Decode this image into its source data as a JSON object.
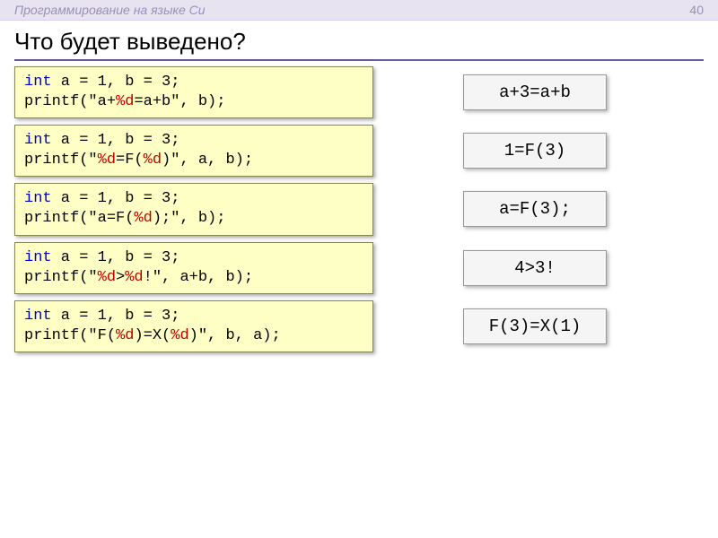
{
  "header": {
    "course": "Программирование на языке Си",
    "page": "40"
  },
  "title": "Что будет выведено?",
  "examples": [
    {
      "l1_kw": "int",
      "l1_rest": " a = 1, b = 3;",
      "l2_pre": "printf(\"a+",
      "l2_red": "%d",
      "l2_post": "=a+b\", b);",
      "output": "a+3=a+b"
    },
    {
      "l1_kw": "int",
      "l1_rest": " a = 1, b = 3;",
      "l2_pre": "printf(\"",
      "l2_red": "%d",
      "l2_mid": "=F(",
      "l2_red2": "%d",
      "l2_post": ")\", a, b);",
      "output": "1=F(3)"
    },
    {
      "l1_kw": "int",
      "l1_rest": " a = 1, b = 3;",
      "l2_pre": "printf(\"a=F(",
      "l2_red": "%d",
      "l2_post": ");\", b);",
      "output": "a=F(3);"
    },
    {
      "l1_kw": "int",
      "l1_rest": " a = 1, b = 3;",
      "l2_pre": "printf(\"",
      "l2_red": "%d",
      "l2_mid": ">",
      "l2_red2": "%d",
      "l2_post": "!\", a+b, b);",
      "output": "4>3!"
    },
    {
      "l1_kw": "int",
      "l1_rest": " a = 1, b = 3;",
      "l2_pre": "printf(\"F(",
      "l2_red": "%d",
      "l2_mid": ")=X(",
      "l2_red2": "%d",
      "l2_post": ")\", b, a);",
      "output": "F(3)=X(1)"
    }
  ]
}
